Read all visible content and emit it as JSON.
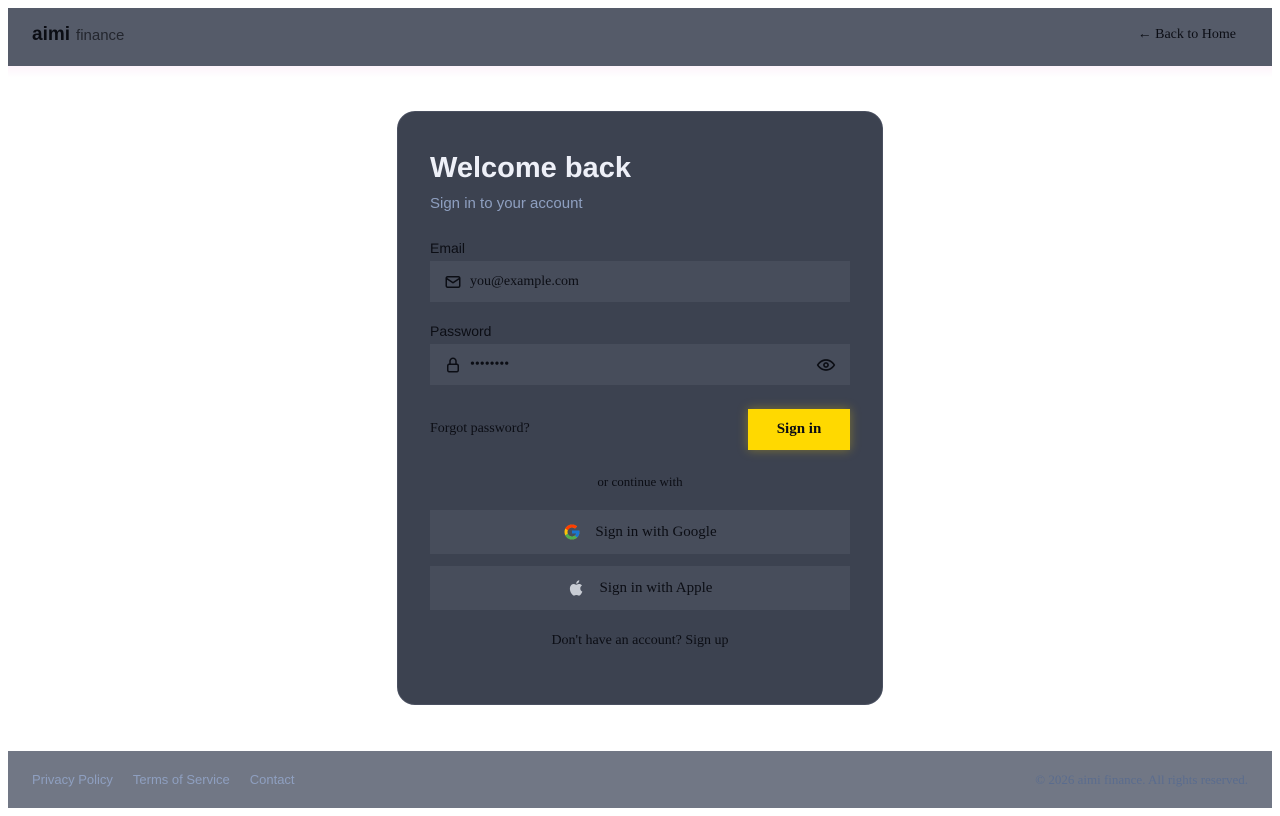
{
  "header": {
    "brand_main": "aimi",
    "brand_sub": "finance",
    "back_link": "← Back to Home"
  },
  "login": {
    "title": "Welcome back",
    "subtitle": "Sign in to your account",
    "email_label": "Email",
    "email_placeholder": "you@example.com",
    "email_value": "",
    "password_label": "Password",
    "password_value": "••••••••",
    "forgot_password": "Forgot password?",
    "signin_button": "Sign in",
    "divider_text": "or continue with",
    "google_button": "Sign in with Google",
    "apple_button": "Sign in with Apple",
    "signup_prompt": "Don't have an account?",
    "signup_link": "Sign up"
  },
  "footer": {
    "links": [
      "Privacy Policy",
      "Terms of Service",
      "Contact"
    ],
    "copyright": "© 2026 aimi finance. All rights reserved."
  },
  "icons": {
    "email": "mail-icon",
    "password": "lock-icon",
    "toggle_password": "eye-icon",
    "google": "google-icon",
    "apple": "apple-icon"
  },
  "colors": {
    "header_bg": "#555b69",
    "card_bg": "#3c4250",
    "input_bg": "#474d5b",
    "accent": "#ffd900",
    "subtitle": "#8e9fc0",
    "footer_bg": "#717785"
  }
}
